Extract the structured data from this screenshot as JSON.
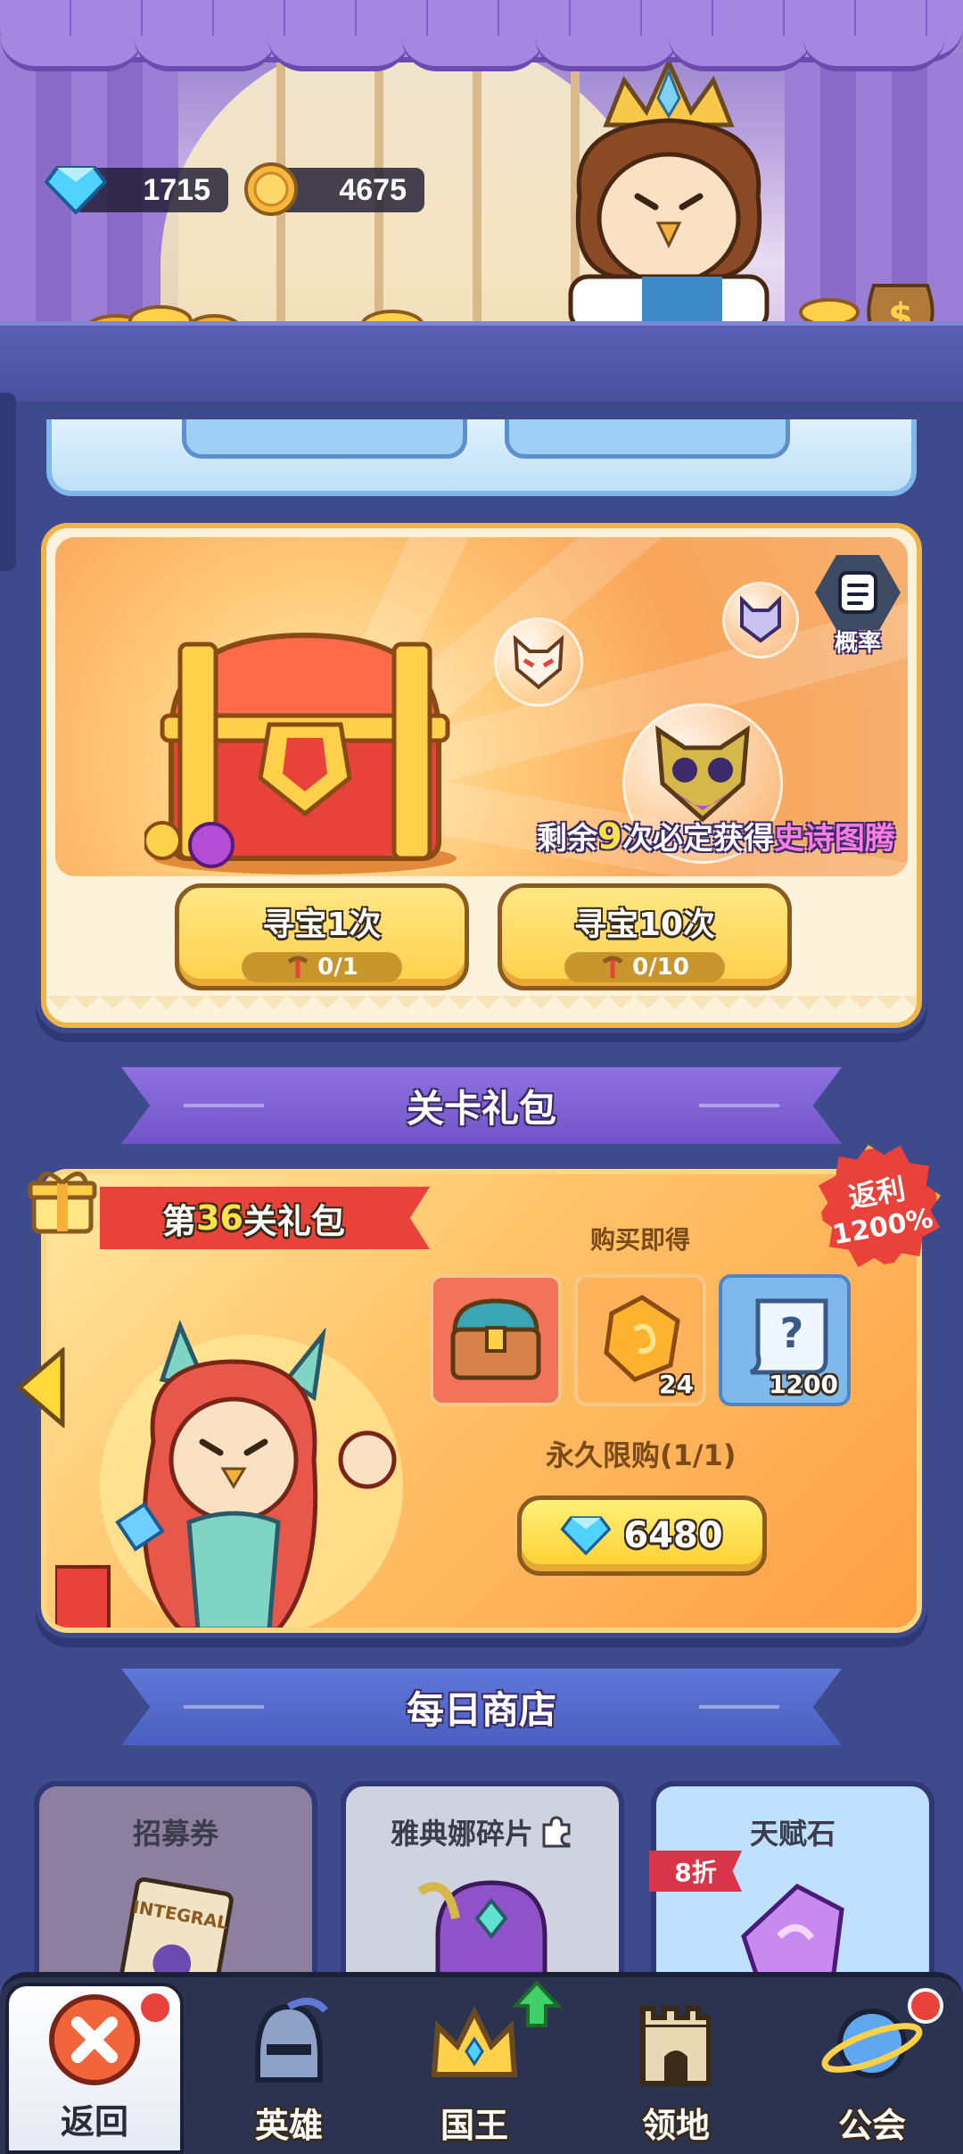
{
  "currency": {
    "diamonds": "1715",
    "coins": "4675"
  },
  "treasure": {
    "probability_label": "概率",
    "guarantee": {
      "prefix": "剩余",
      "count": "9",
      "middle": "次必定获得",
      "reward": "史诗图腾"
    },
    "hunt_once": {
      "label": "寻宝1次",
      "cost": "0/1"
    },
    "hunt_ten": {
      "label": "寻宝10次",
      "cost": "0/10"
    }
  },
  "stage_gift": {
    "section_title": "关卡礼包",
    "ribbon_prefix": "第",
    "ribbon_number": "36",
    "ribbon_suffix": "关礼包",
    "rebate_line1": "返利",
    "rebate_line2": "1200%",
    "buy_get_label": "购买即得",
    "rewards": [
      {
        "icon": "treasure-chest-icon",
        "qty": ""
      },
      {
        "icon": "golden-stone-icon",
        "qty": "24"
      },
      {
        "icon": "mystery-scroll-icon",
        "qty": "1200"
      }
    ],
    "limit_label": "永久限购(1/1)",
    "price": "6480"
  },
  "daily_shop": {
    "section_title": "每日商店",
    "items": [
      {
        "title": "招募券",
        "icon": "recruit-ticket-icon"
      },
      {
        "title": "雅典娜碎片",
        "icon": "athena-shard-icon"
      },
      {
        "title": "天赋石",
        "icon": "talent-stone-icon",
        "discount": "8折"
      }
    ]
  },
  "nav": {
    "items": [
      {
        "label": "返回",
        "icon": "close-icon"
      },
      {
        "label": "英雄",
        "icon": "helmet-icon"
      },
      {
        "label": "国王",
        "icon": "crown-icon"
      },
      {
        "label": "领地",
        "icon": "castle-icon"
      },
      {
        "label": "公会",
        "icon": "planet-icon"
      }
    ]
  },
  "colors": {
    "background": "#3f4a8c",
    "accent_gold": "#ffd04a",
    "accent_red": "#e8423a",
    "purple_banner": "#7f63d6",
    "blue_banner": "#4f63c9"
  }
}
